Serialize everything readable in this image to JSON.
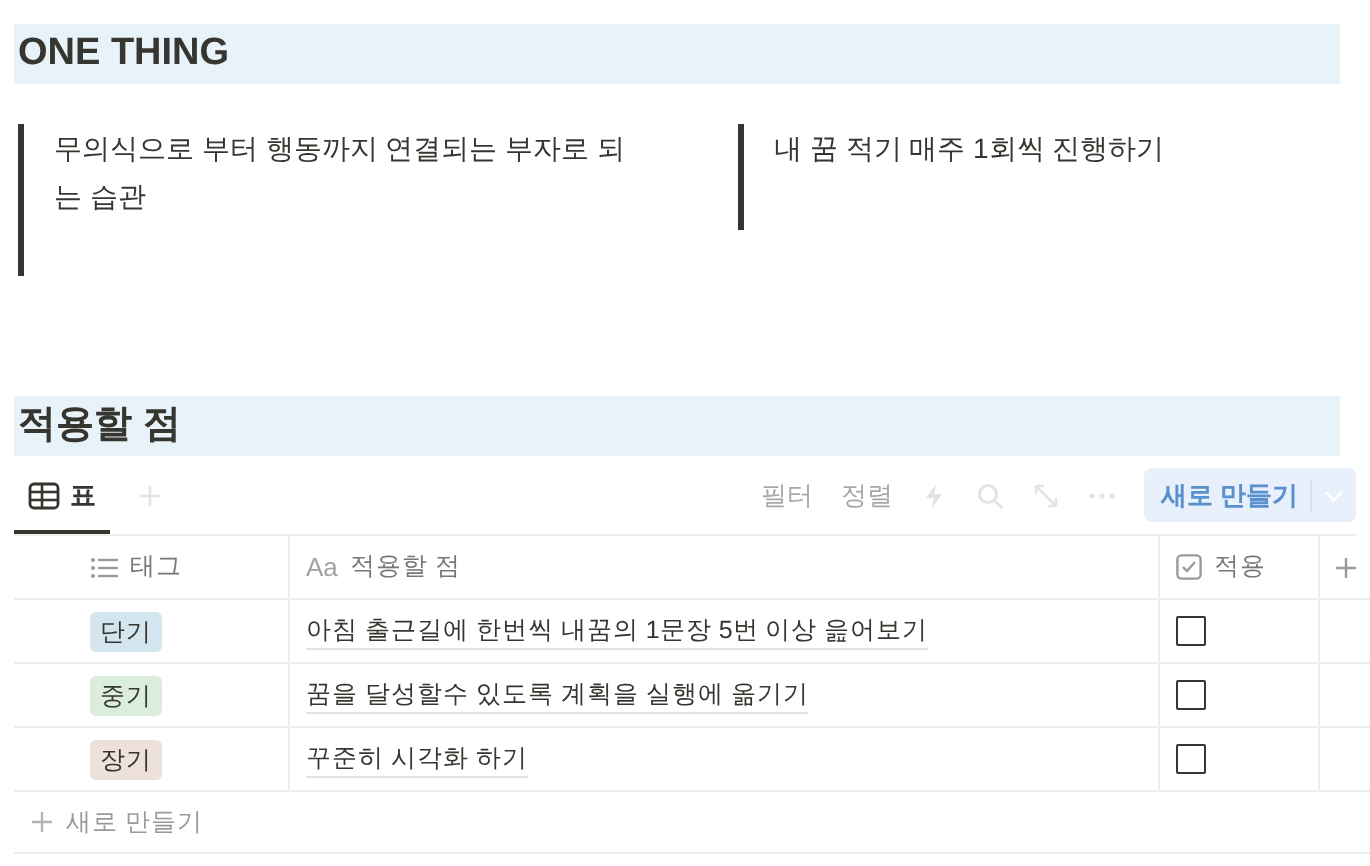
{
  "sections": [
    {
      "heading": "ONE THING",
      "quotes": [
        "무의식으로 부터 행동까지 연결되는 부자로 되는 습관",
        "내 꿈 적기 매주 1회씩 진행하기"
      ]
    },
    {
      "heading": "적용할 점"
    }
  ],
  "view_tabs": [
    {
      "label": "표",
      "selected": true
    }
  ],
  "toolbar": {
    "filter": "필터",
    "sort": "정렬",
    "new_button": "새로 만들기"
  },
  "table": {
    "columns": [
      {
        "kind": "list",
        "label": "태그"
      },
      {
        "kind": "title",
        "icon_text": "Aa",
        "label": "적용할 점"
      },
      {
        "kind": "check",
        "label": "적용"
      }
    ],
    "rows": [
      {
        "tag": "단기",
        "color": "#d3e5ef",
        "text": "아침 출근길에 한번씩 내꿈의 1문장 5번 이상 읊어보기",
        "checked": false
      },
      {
        "tag": "중기",
        "color": "#dbeddb",
        "text": "꿈을 달성할수 있도록 계획을 실행에 옮기기",
        "checked": false
      },
      {
        "tag": "장기",
        "color": "#eee0da",
        "text": "꾸준히 시각화 하기",
        "checked": false
      }
    ],
    "new_row": "새로 만들기"
  }
}
